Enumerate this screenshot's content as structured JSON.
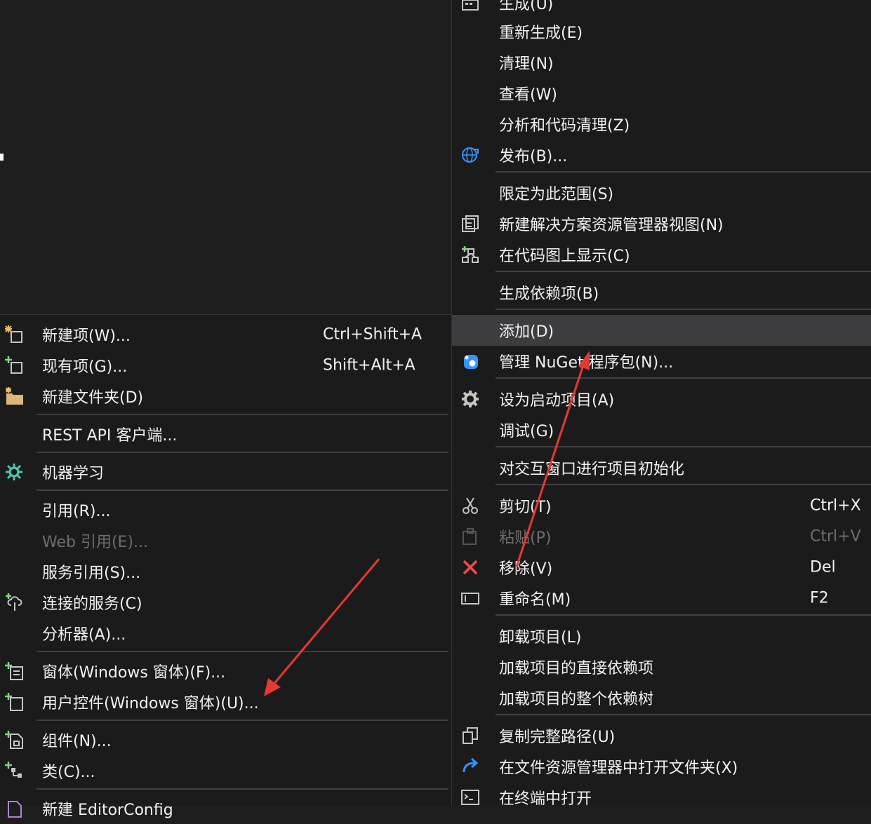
{
  "right_menu": {
    "items": [
      {
        "label": "生成(U)",
        "shortcut": ""
      },
      {
        "label": "重新生成(E)",
        "shortcut": ""
      },
      {
        "label": "清理(N)",
        "shortcut": ""
      },
      {
        "label": "查看(W)",
        "shortcut": ""
      },
      {
        "label": "分析和代码清理(Z)",
        "shortcut": ""
      },
      {
        "label": "发布(B)...",
        "shortcut": ""
      },
      {
        "label": "限定为此范围(S)",
        "shortcut": ""
      },
      {
        "label": "新建解决方案资源管理器视图(N)",
        "shortcut": ""
      },
      {
        "label": "在代码图上显示(C)",
        "shortcut": ""
      },
      {
        "label": "生成依赖项(B)",
        "shortcut": ""
      },
      {
        "label": "添加(D)",
        "shortcut": ""
      },
      {
        "label": "管理 NuGet 程序包(N)...",
        "shortcut": ""
      },
      {
        "label": "设为启动项目(A)",
        "shortcut": ""
      },
      {
        "label": "调试(G)",
        "shortcut": ""
      },
      {
        "label": "对交互窗口进行项目初始化",
        "shortcut": ""
      },
      {
        "label": "剪切(T)",
        "shortcut": "Ctrl+X"
      },
      {
        "label": "粘贴(P)",
        "shortcut": "Ctrl+V"
      },
      {
        "label": "移除(V)",
        "shortcut": "Del"
      },
      {
        "label": "重命名(M)",
        "shortcut": "F2"
      },
      {
        "label": "卸载项目(L)",
        "shortcut": ""
      },
      {
        "label": "加载项目的直接依赖项",
        "shortcut": ""
      },
      {
        "label": "加载项目的整个依赖树",
        "shortcut": ""
      },
      {
        "label": "复制完整路径(U)",
        "shortcut": ""
      },
      {
        "label": "在文件资源管理器中打开文件夹(X)",
        "shortcut": ""
      },
      {
        "label": "在终端中打开",
        "shortcut": ""
      }
    ]
  },
  "left_menu": {
    "items": [
      {
        "label": "新建项(W)...",
        "shortcut": "Ctrl+Shift+A"
      },
      {
        "label": "现有项(G)...",
        "shortcut": "Shift+Alt+A"
      },
      {
        "label": "新建文件夹(D)",
        "shortcut": ""
      },
      {
        "label": "REST API 客户端...",
        "shortcut": ""
      },
      {
        "label": "机器学习",
        "shortcut": ""
      },
      {
        "label": "引用(R)...",
        "shortcut": ""
      },
      {
        "label": "Web 引用(E)...",
        "shortcut": ""
      },
      {
        "label": "服务引用(S)...",
        "shortcut": ""
      },
      {
        "label": "连接的服务(C)",
        "shortcut": ""
      },
      {
        "label": "分析器(A)...",
        "shortcut": ""
      },
      {
        "label": "窗体(Windows 窗体)(F)...",
        "shortcut": ""
      },
      {
        "label": "用户控件(Windows 窗体)(U)...",
        "shortcut": ""
      },
      {
        "label": "组件(N)...",
        "shortcut": ""
      },
      {
        "label": "类(C)...",
        "shortcut": ""
      },
      {
        "label": "新建 EditorConfig",
        "shortcut": ""
      }
    ]
  },
  "colors": {
    "menu_bg": "#1b1b1c",
    "hover_bg": "#3d3d40",
    "text": "#f1f1f1",
    "disabled_text": "#6d6d6d",
    "separator": "#3f3f46",
    "annotation_arrow": "#e53935",
    "icon_blue": "#3794ff",
    "icon_green": "#89d185",
    "icon_red": "#f14c4c"
  }
}
